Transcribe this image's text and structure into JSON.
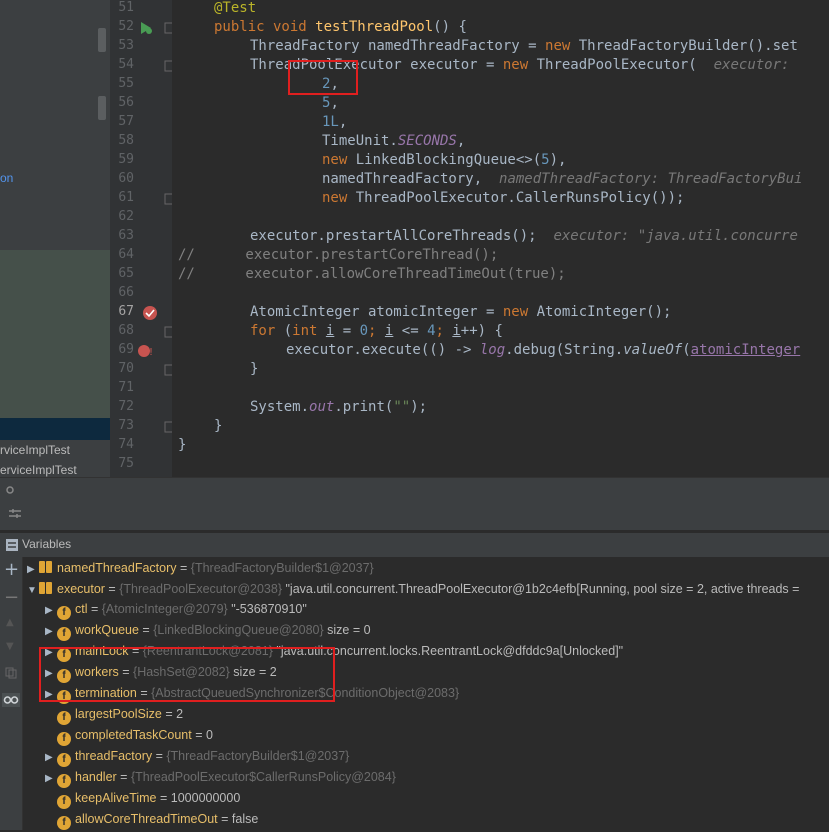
{
  "project_panel": {
    "items": [
      {
        "label": "on"
      },
      {
        "label": "rviceImplTest"
      },
      {
        "label": "erviceImplTest"
      }
    ]
  },
  "editor": {
    "lines": [
      {
        "num": "51"
      },
      {
        "num": "52"
      },
      {
        "num": "53"
      },
      {
        "num": "54"
      },
      {
        "num": "55"
      },
      {
        "num": "56"
      },
      {
        "num": "57"
      },
      {
        "num": "58"
      },
      {
        "num": "59"
      },
      {
        "num": "60"
      },
      {
        "num": "61"
      },
      {
        "num": "62"
      },
      {
        "num": "63"
      },
      {
        "num": "64"
      },
      {
        "num": "65"
      },
      {
        "num": "66"
      },
      {
        "num": "67"
      },
      {
        "num": "68"
      },
      {
        "num": "69"
      },
      {
        "num": "70"
      },
      {
        "num": "71"
      },
      {
        "num": "72"
      },
      {
        "num": "73"
      },
      {
        "num": "74"
      },
      {
        "num": "75"
      }
    ],
    "code": {
      "l51_anno": "@Test",
      "l52_kw": "public void ",
      "l52_fn": "testThreadPool",
      "l52_rest": "() {",
      "l53_a": "ThreadFactory namedThreadFactory = ",
      "l53_kw": "new ",
      "l53_b": "ThreadFactoryBuilder().set",
      "l54_a": "ThreadPoolExecutor executor = ",
      "l54_kw": "new ",
      "l54_b": "ThreadPoolExecutor(  ",
      "l54_hint": "executor: ",
      "l55_num": "2",
      "l55_rest": ",",
      "l56_num": "5",
      "l56_rest": ",",
      "l57_num": "1L",
      "l57_rest": ",",
      "l58_a": "TimeUnit.",
      "l58_it": "SECONDS",
      "l58_rest": ",",
      "l59_kw": "new ",
      "l59_a": "LinkedBlockingQueue<>(",
      "l59_num": "5",
      "l59_rest": "),",
      "l60_a": "namedThreadFactory,  ",
      "l60_hint": "namedThreadFactory: ThreadFactoryBui",
      "l61_kw": "new ",
      "l61_a": "ThreadPoolExecutor.CallerRunsPolicy());",
      "l63_a": "executor.prestartAllCoreThreads();  ",
      "l63_hint": "executor: \"java.util.concurre",
      "l64_c": "//      executor.prestartCoreThread();",
      "l65_c": "//      executor.allowCoreThreadTimeOut(true);",
      "l67_a": "AtomicInteger atomicInteger = ",
      "l67_kw": "new ",
      "l67_b": "AtomicInteger();",
      "l68_kw": "for ",
      "l68_a": "(",
      "l68_kw2": "int ",
      "l68_i": "i",
      "l68_b": " = ",
      "l68_n0": "0",
      "l68_c": "; ",
      "l68_i2": "i",
      "l68_d": " <= ",
      "l68_n4": "4",
      "l68_e": "; ",
      "l68_i3": "i",
      "l68_f": "++) {",
      "l69_a": "executor.execute(() -> ",
      "l69_log": "log",
      "l69_b": ".debug(String.",
      "l69_m": "valueOf",
      "l69_c": "(",
      "l69_d": "atomicInteger",
      "l70": "}",
      "l72_a": "System.",
      "l72_out": "out",
      "l72_b": ".print(",
      "l72_s": "\"\"",
      "l72_c": ");",
      "l73": "}",
      "l74": "}"
    }
  },
  "debugger": {
    "panel_title": "Variables",
    "variables": [
      {
        "name": "namedThreadFactory",
        "eq": " = ",
        "type": "{ThreadFactoryBuilder$1@2037}",
        "value": ""
      },
      {
        "name": "executor",
        "eq": " = ",
        "type": "{ThreadPoolExecutor@2038}",
        "value": " \"java.util.concurrent.ThreadPoolExecutor@1b2c4efb[Running, pool size = 2, active threads ="
      },
      {
        "name": "ctl",
        "eq": " = ",
        "type": "{AtomicInteger@2079}",
        "value": " \"-536870910\""
      },
      {
        "name": "workQueue",
        "eq": " = ",
        "type": "{LinkedBlockingQueue@2080}",
        "value": "  size = 0"
      },
      {
        "name": "mainLock",
        "eq": " = ",
        "type": "{ReentrantLock@2081}",
        "value": " \"java.util.concurrent.locks.ReentrantLock@dfddc9a[Unlocked]\""
      },
      {
        "name": "workers",
        "eq": " = ",
        "type": "{HashSet@2082}",
        "value": "  size = 2"
      },
      {
        "name": "termination",
        "eq": " = ",
        "type": "{AbstractQueuedSynchronizer$ConditionObject@2083}",
        "value": ""
      },
      {
        "name": "largestPoolSize",
        "eq": " = ",
        "type": "",
        "value": "2"
      },
      {
        "name": "completedTaskCount",
        "eq": " = ",
        "type": "",
        "value": "0"
      },
      {
        "name": "threadFactory",
        "eq": " = ",
        "type": "{ThreadFactoryBuilder$1@2037}",
        "value": ""
      },
      {
        "name": "handler",
        "eq": " = ",
        "type": "{ThreadPoolExecutor$CallerRunsPolicy@2084}",
        "value": ""
      },
      {
        "name": "keepAliveTime",
        "eq": " = ",
        "type": "",
        "value": "1000000000"
      },
      {
        "name": "allowCoreThreadTimeOut",
        "eq": " = ",
        "type": "",
        "value": "false"
      }
    ]
  }
}
